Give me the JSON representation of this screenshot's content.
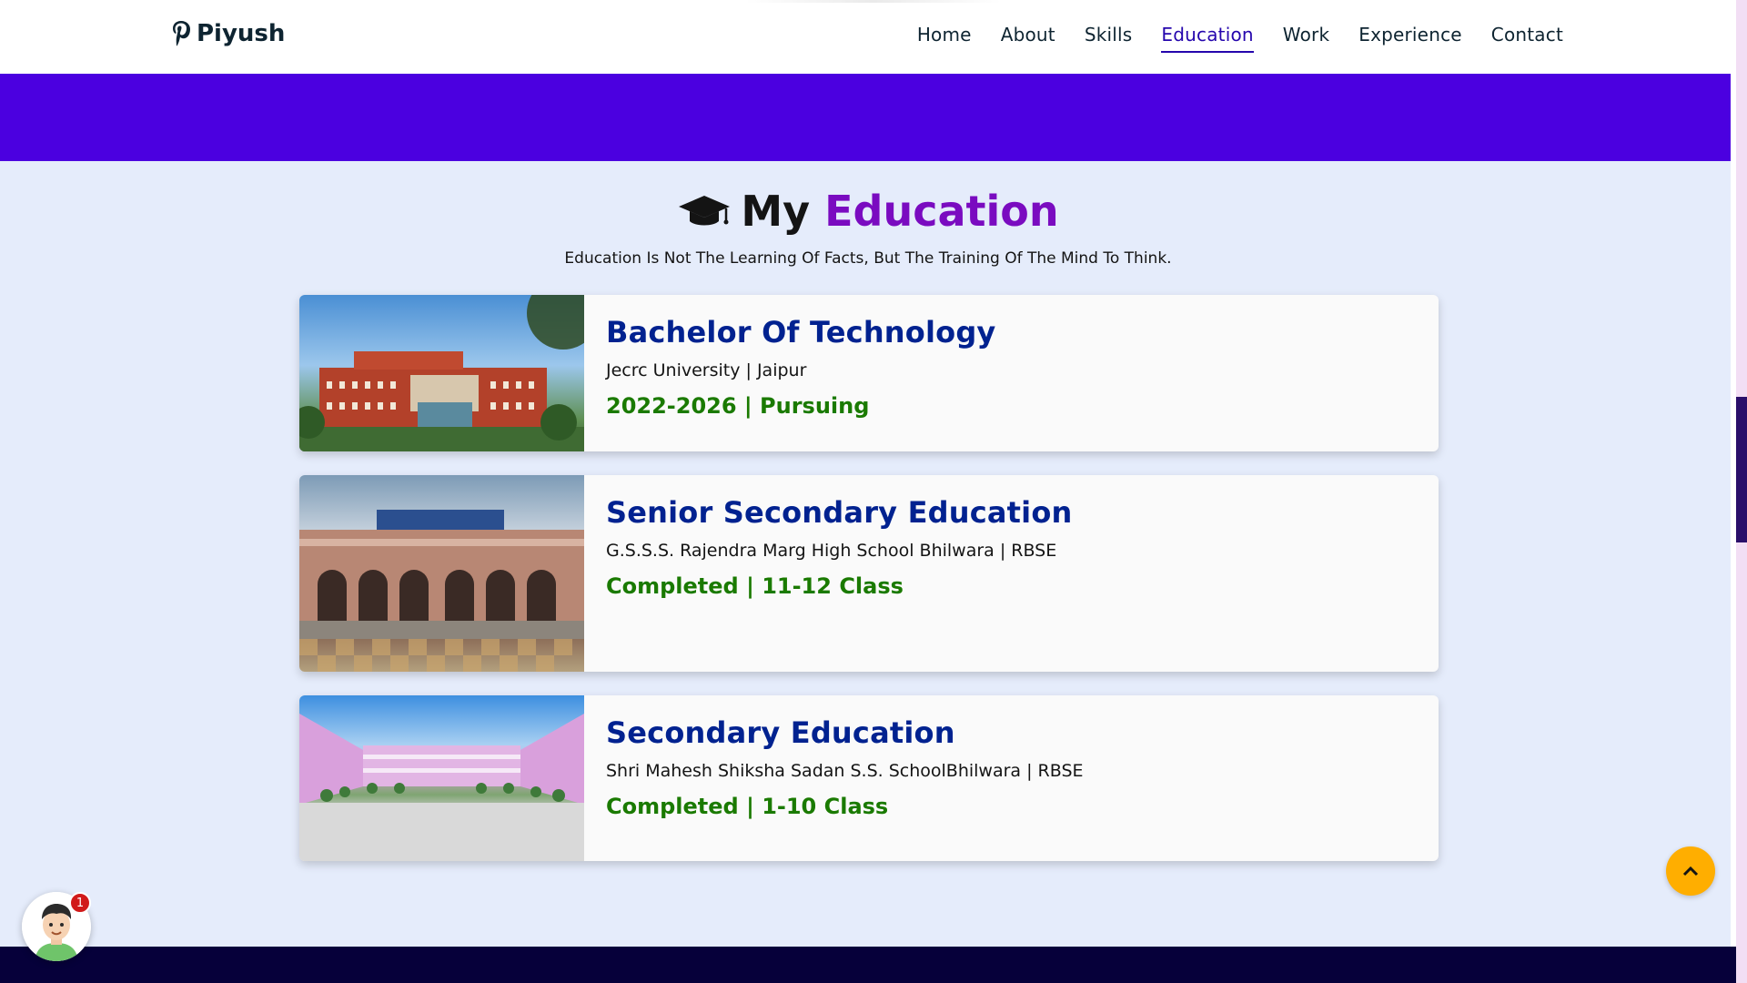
{
  "logo": {
    "text": "Piyush"
  },
  "nav": {
    "items": [
      "Home",
      "About",
      "Skills",
      "Education",
      "Work",
      "Experience",
      "Contact"
    ],
    "active": "Education"
  },
  "education": {
    "heading_prefix": "My",
    "heading_highlight": "Education",
    "quote": "Education Is Not The Learning Of Facts, But The Training Of The Mind To Think.",
    "cards": [
      {
        "title": "Bachelor Of Technology",
        "institution": "Jecrc University | Jaipur",
        "status": "2022-2026 | Pursuing"
      },
      {
        "title": "Senior Secondary Education",
        "institution": "G.S.S.S. Rajendra Marg High School Bhilwara | RBSE",
        "status": "Completed | 11-12 Class"
      },
      {
        "title": "Secondary Education",
        "institution": "Shri Mahesh Shiksha Sadan S.S. SchoolBhilwara | RBSE",
        "status": "Completed | 1-10 Class"
      }
    ]
  },
  "chat": {
    "badge_count": "1"
  },
  "colors": {
    "accent": "#4b00e0",
    "highlight": "#7a0bc0",
    "card_title": "#012290",
    "status_green": "#1a7a00",
    "to_top": "#ffae00"
  }
}
